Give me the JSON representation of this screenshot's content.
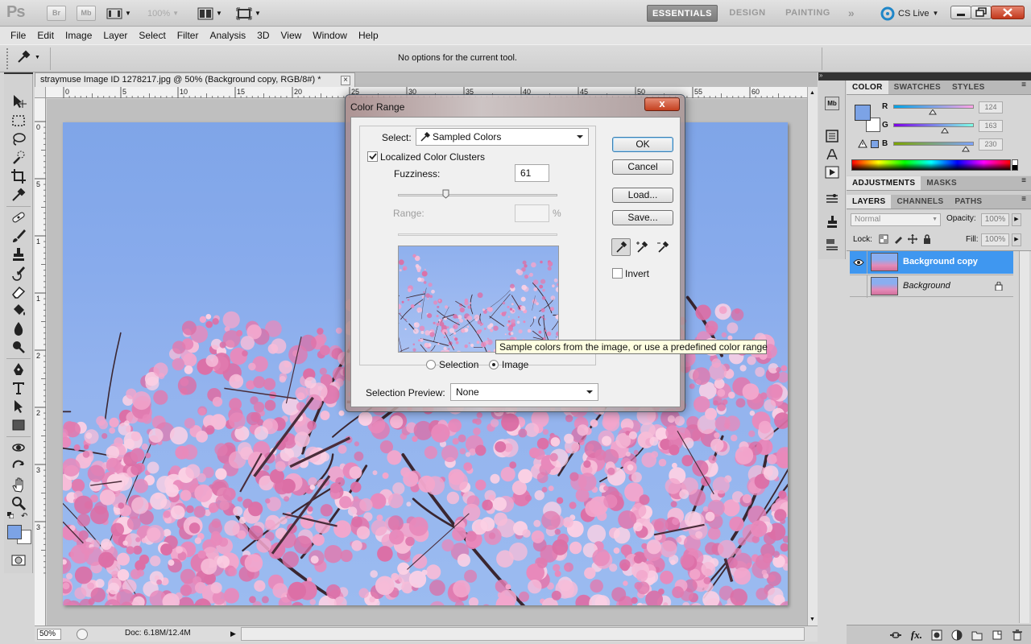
{
  "appbar": {
    "logo": "Ps",
    "br_label": "Br",
    "mb_label": "Mb",
    "zoom": "100%",
    "workspaces": [
      "ESSENTIALS",
      "DESIGN",
      "PAINTING"
    ],
    "more": "»",
    "cs_live": "CS Live"
  },
  "menu": [
    "File",
    "Edit",
    "Image",
    "Layer",
    "Select",
    "Filter",
    "Analysis",
    "3D",
    "View",
    "Window",
    "Help"
  ],
  "options": {
    "message": "No options for the current tool."
  },
  "document": {
    "tab_title": "straymuse Image ID 1278217.jpg @ 50% (Background copy, RGB/8#) *",
    "close": "×",
    "ruler_top_ticks": [
      "0",
      "5",
      "10",
      "15",
      "20",
      "25",
      "30",
      "35",
      "40",
      "45",
      "50",
      "55",
      "60"
    ],
    "ruler_left_ticks": [
      "0",
      "5",
      "1",
      "1",
      "2",
      "2",
      "3",
      "3"
    ],
    "status_zoom": "50%",
    "status_doc": "Doc: 6.18M/12.4M"
  },
  "color_panel": {
    "tabs": [
      "COLOR",
      "SWATCHES",
      "STYLES"
    ],
    "fg_color": "#7ca3e6",
    "channels": [
      {
        "label": "R",
        "value": "124",
        "position": 0.486
      },
      {
        "label": "G",
        "value": "163",
        "position": 0.639
      },
      {
        "label": "B",
        "value": "230",
        "position": 0.902
      }
    ]
  },
  "adjustments_panel": {
    "tabs": [
      "ADJUSTMENTS",
      "MASKS"
    ]
  },
  "layers_panel": {
    "tabs": [
      "LAYERS",
      "CHANNELS",
      "PATHS"
    ],
    "blend_mode": "Normal",
    "opacity_label": "Opacity:",
    "opacity_value": "100%",
    "lock_label": "Lock:",
    "fill_label": "Fill:",
    "fill_value": "100%",
    "layers": [
      {
        "name": "Background copy",
        "selected": true,
        "visible": true
      },
      {
        "name": "Background",
        "selected": false,
        "visible": false,
        "locked": true
      }
    ]
  },
  "dialog": {
    "title": "Color Range",
    "close": "x",
    "select_label": "Select:",
    "select_value": "Sampled Colors",
    "localized_label": "Localized Color Clusters",
    "localized_checked": true,
    "fuzziness_label": "Fuzziness:",
    "fuzziness_value": "61",
    "fuzziness_position": 0.3,
    "range_label": "Range:",
    "range_value": "",
    "range_unit": "%",
    "selection_radio": "Selection",
    "image_radio": "Image",
    "image_selected": true,
    "preview_label": "Selection Preview:",
    "preview_value": "None",
    "buttons": {
      "ok": "OK",
      "cancel": "Cancel",
      "load": "Load...",
      "save": "Save..."
    },
    "invert_label": "Invert",
    "invert_checked": false
  },
  "tooltip": "Sample colors from the image, or use a predefined color range",
  "colors": {
    "sky": "#8aaef0",
    "blossom": "#e68ab9",
    "blossom_dark": "#c85a8e",
    "accent_blue": "#3f97f0"
  }
}
